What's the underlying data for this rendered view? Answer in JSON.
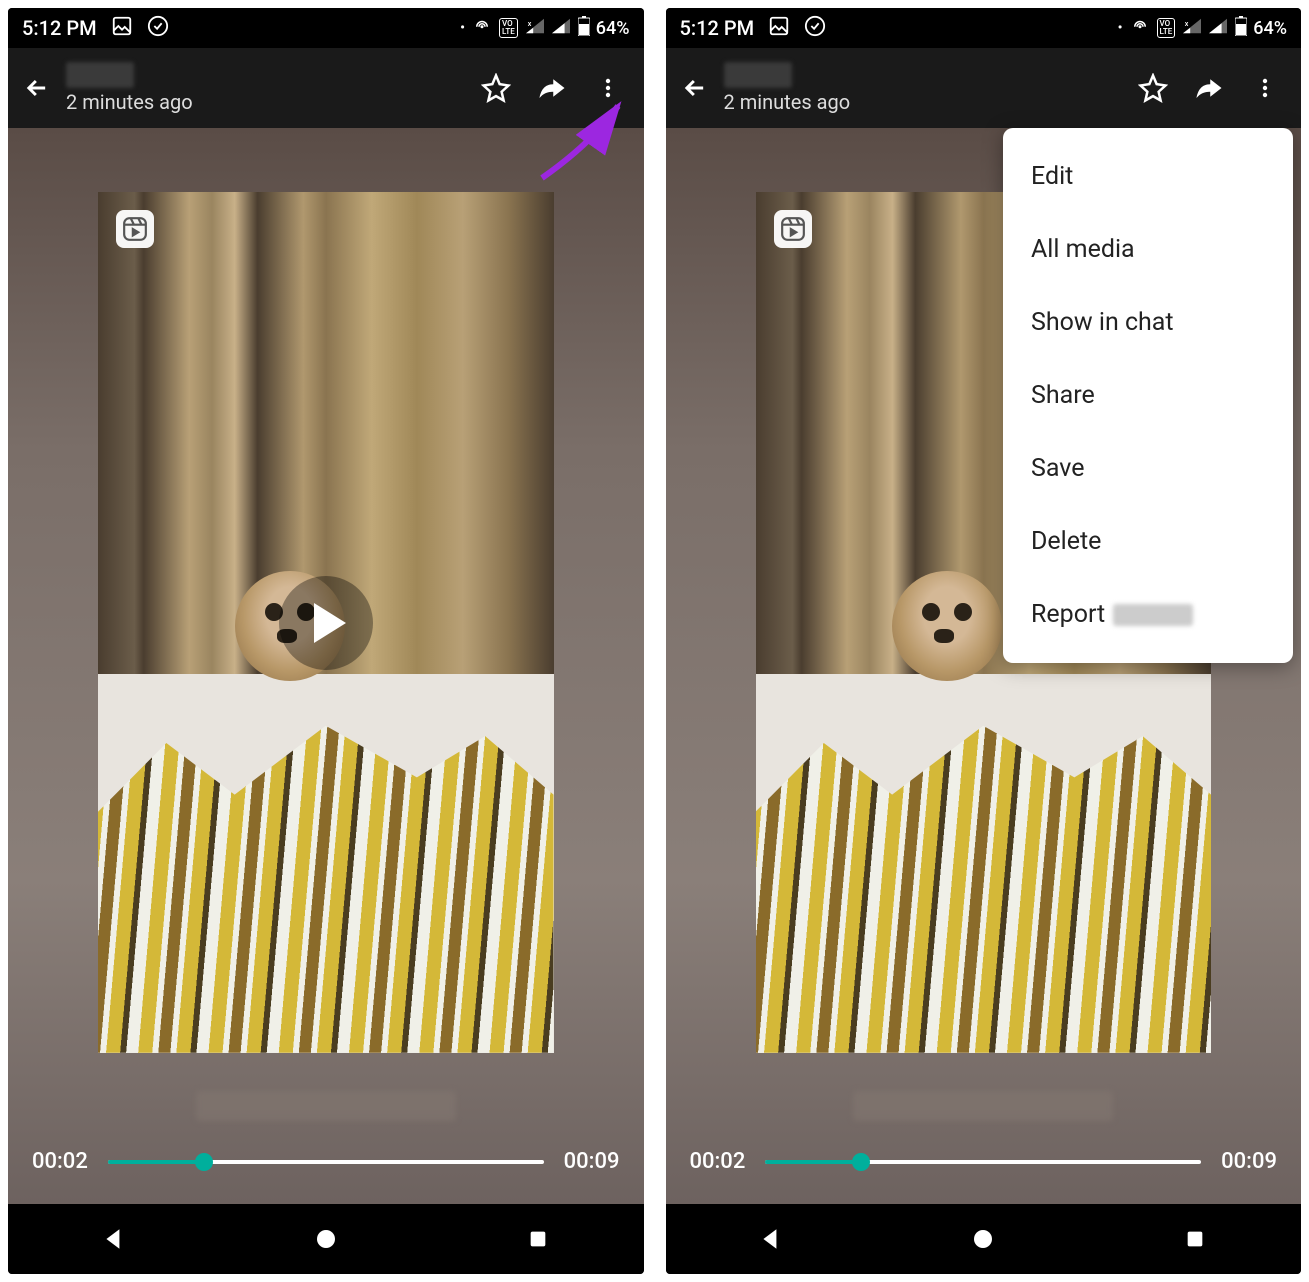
{
  "status": {
    "time": "5:12 PM",
    "battery_pct": "64%"
  },
  "header": {
    "subtitle": "2 minutes ago"
  },
  "player": {
    "current_time": "00:02",
    "duration": "00:09"
  },
  "menu": {
    "items": [
      {
        "label": "Edit"
      },
      {
        "label": "All media"
      },
      {
        "label": "Show in chat"
      },
      {
        "label": "Share"
      },
      {
        "label": "Save"
      },
      {
        "label": "Delete"
      },
      {
        "label": "Report"
      }
    ]
  }
}
